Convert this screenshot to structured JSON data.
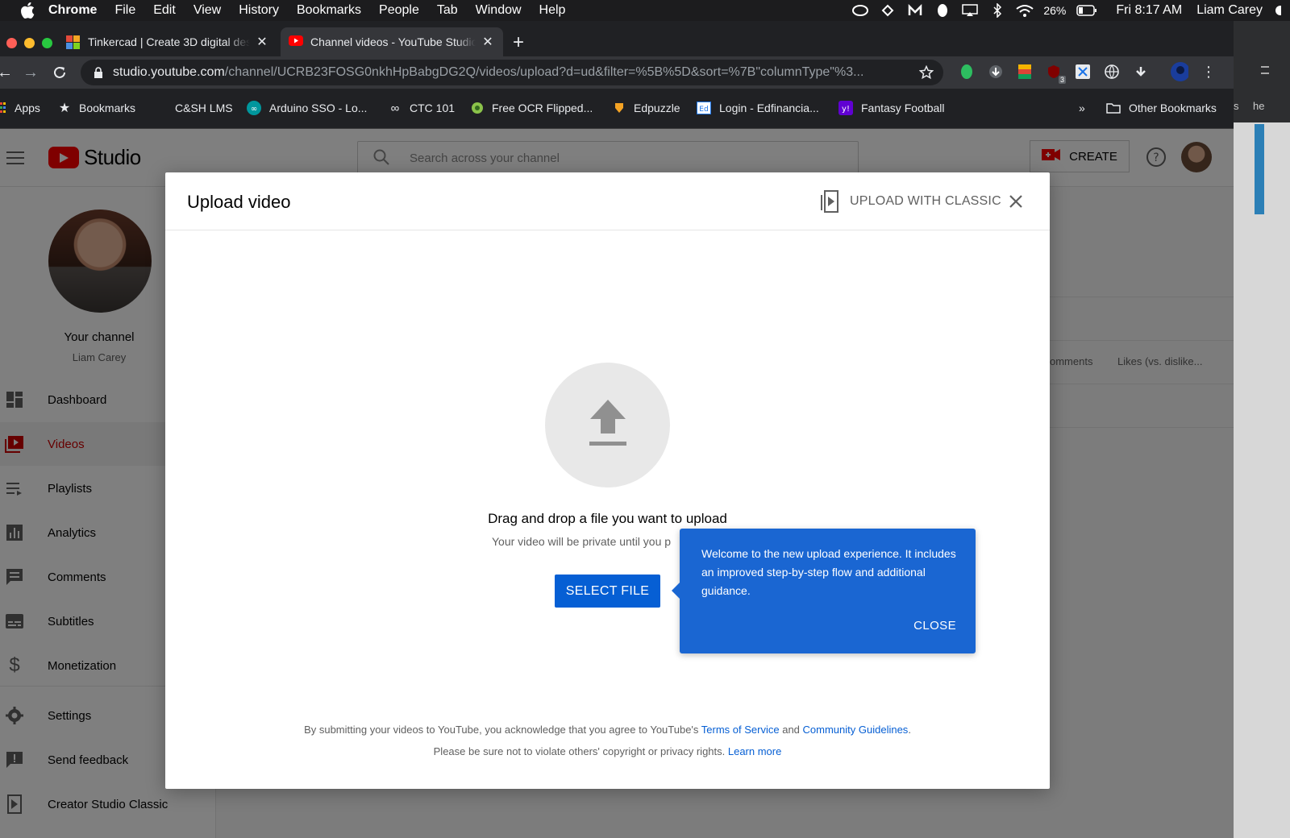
{
  "menubar": {
    "app": "Chrome",
    "items": [
      "File",
      "Edit",
      "View",
      "History",
      "Bookmarks",
      "People",
      "Tab",
      "Window",
      "Help"
    ],
    "battery": "26%",
    "clock": "Fri 8:17 AM",
    "user": "Liam Carey"
  },
  "tabs": [
    {
      "title": "Tinkercad | Create 3D digital designs",
      "favicon": "tinkercad-icon"
    },
    {
      "title": "Channel videos - YouTube Studio",
      "favicon": "youtube-icon"
    }
  ],
  "omnibox": {
    "host": "studio.youtube.com",
    "path": "/channel/UCRB23FOSG0nkhHpBabgDG2Q/videos/upload?d=ud&filter=%5B%5D&sort=%7B\"columnType\"%3..."
  },
  "bookmarks": {
    "items": [
      "Apps",
      "Bookmarks",
      "C&SH LMS",
      "Arduino SSO - Lo...",
      "CTC 101",
      "Free OCR Flipped...",
      "Edpuzzle",
      "Login - Edfinancia...",
      "Fantasy Football"
    ],
    "overflow": "»",
    "other": "Other Bookmarks"
  },
  "side_window": {
    "text1": "s",
    "text2": "he"
  },
  "studio": {
    "logo_text": "Studio",
    "search_placeholder": "Search across your channel",
    "create_label": "CREATE",
    "channel_title": "Your channel",
    "channel_name": "Liam Carey",
    "nav": [
      {
        "label": "Dashboard",
        "icon": "dashboard-icon"
      },
      {
        "label": "Videos",
        "icon": "videos-icon",
        "active": true
      },
      {
        "label": "Playlists",
        "icon": "playlists-icon"
      },
      {
        "label": "Analytics",
        "icon": "analytics-icon"
      },
      {
        "label": "Comments",
        "icon": "comments-icon"
      },
      {
        "label": "Subtitles",
        "icon": "subtitles-icon"
      },
      {
        "label": "Monetization",
        "icon": "monetization-icon"
      },
      {
        "label": "Settings",
        "icon": "settings-icon"
      },
      {
        "label": "Send feedback",
        "icon": "feedback-icon"
      },
      {
        "label": "Creator Studio Classic",
        "icon": "creator-classic-icon"
      }
    ],
    "columns_visible": [
      "omments",
      "Likes (vs. dislike..."
    ]
  },
  "dialog": {
    "title": "Upload video",
    "classic_label": "UPLOAD WITH CLASSIC",
    "drag_text": "Drag and drop a file you want to upload",
    "private_text": "Your video will be private until you p",
    "select_label": "SELECT FILE",
    "legal_line1_prefix": "By submitting your videos to YouTube, you acknowledge that you agree to YouTube's ",
    "terms_link": "Terms of Service",
    "legal_and": " and ",
    "guidelines_link": "Community Guidelines",
    "legal_period": ".",
    "legal_line2": "Please be sure not to violate others' copyright or privacy rights. ",
    "learn_more": "Learn more"
  },
  "tooltip": {
    "text": "Welcome to the new upload experience. It includes an improved step-by-step flow and additional guidance.",
    "close_label": "CLOSE"
  },
  "colors": {
    "accent_blue": "#065fd4",
    "tooltip_blue": "#1a66d2",
    "youtube_red": "#ff0000",
    "active_nav_red": "#cc0000"
  }
}
